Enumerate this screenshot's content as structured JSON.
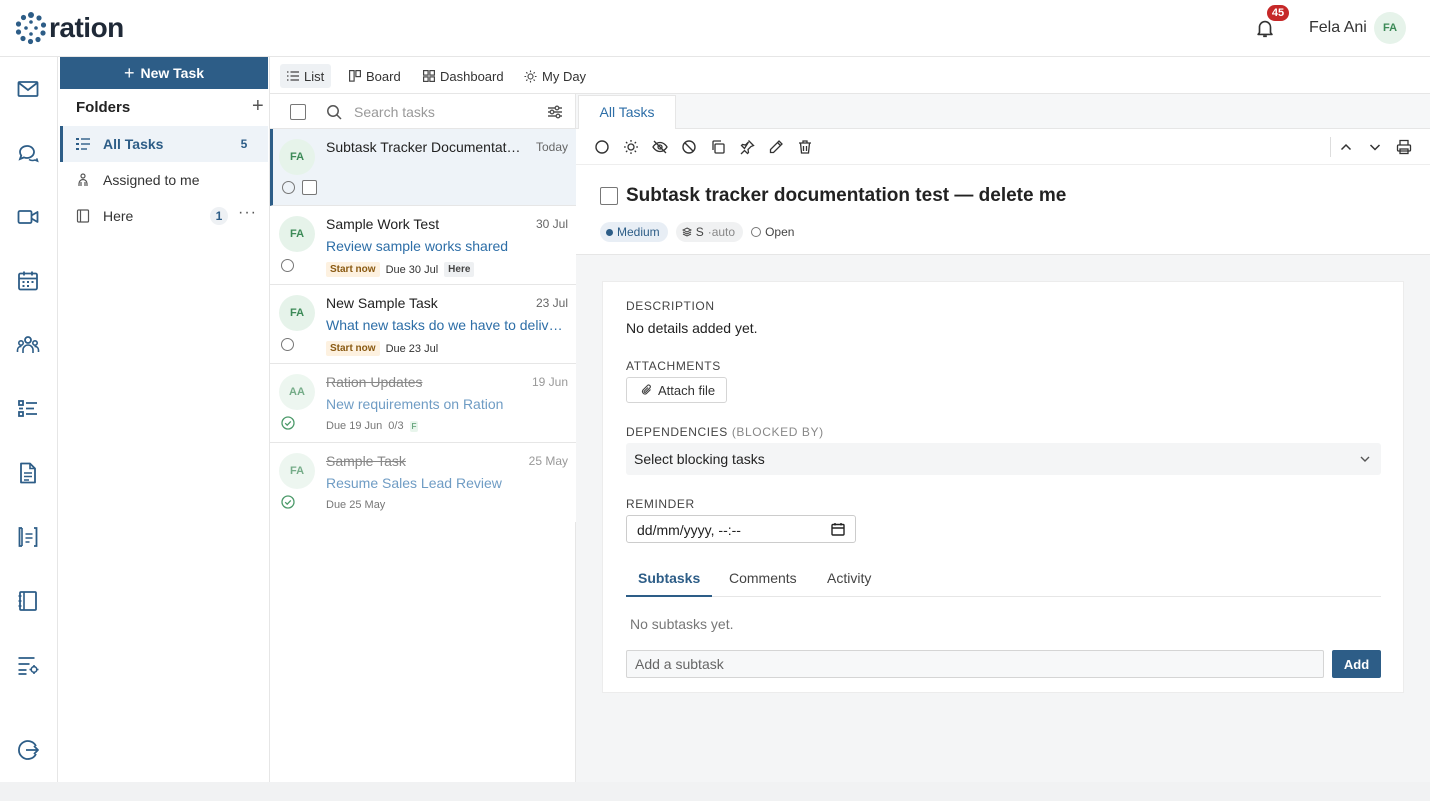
{
  "app": {
    "logo_text": "ration",
    "brand_color": "#2d5d87"
  },
  "header": {
    "notification_count": "45",
    "user_name": "Fela Ani",
    "user_initials": "FA"
  },
  "rail": {
    "icons": [
      "mail-icon",
      "chat-icon",
      "video-icon",
      "calendar-icon",
      "team-icon",
      "tasks-icon",
      "document-icon",
      "handbook-icon",
      "notebook-icon",
      "settings-list-icon",
      "logout-icon"
    ]
  },
  "folders": {
    "new_task_label": "New Task",
    "title": "Folders",
    "add_symbol": "+",
    "items": [
      {
        "label": "All Tasks",
        "count": "5",
        "active": true
      },
      {
        "label": "Assigned to me",
        "count": ""
      },
      {
        "label": "Here",
        "count": "1",
        "more": "···"
      }
    ]
  },
  "view_tabs": [
    {
      "label": "List",
      "active": true
    },
    {
      "label": "Board"
    },
    {
      "label": "Dashboard"
    },
    {
      "label": "My Day"
    }
  ],
  "task_list": {
    "search_placeholder": "Search tasks",
    "tasks": [
      {
        "initials": "FA",
        "title": "Subtask Tracker Documentation test — delete me",
        "date": "Today",
        "selected": true
      },
      {
        "initials": "FA",
        "title": "Sample Work Test",
        "date": "30 Jul",
        "subtitle": "Review sample works shared",
        "start": "Start now",
        "due": "Due 30 Jul",
        "tag": "Here"
      },
      {
        "initials": "FA",
        "title": "New Sample Task",
        "date": "23 Jul",
        "subtitle": "What new tasks do we have to deliver?",
        "start": "Start now",
        "due": "Due 23 Jul"
      },
      {
        "initials": "AA",
        "title": "Ration Updates",
        "date": "19 Jun",
        "subtitle": "New requirements on Ration",
        "due": "Due 19 Jun",
        "progress": "0/3",
        "flag": "F",
        "done": true
      },
      {
        "initials": "FA",
        "title": "Sample Task",
        "date": "25 May",
        "subtitle": "Resume Sales Lead Review",
        "due": "Due 25 May",
        "done": true
      }
    ]
  },
  "detail": {
    "tab_label": "All Tasks",
    "title": "Subtask tracker documentation test — delete me",
    "priority": "Medium",
    "size": "S",
    "size_suffix": "·auto",
    "status": "Open",
    "description_label": "DESCRIPTION",
    "description_text": "No details added yet.",
    "attachments_label": "ATTACHMENTS",
    "attach_button": "Attach file",
    "dependencies_label": "DEPENDENCIES",
    "dependencies_sub": "(BLOCKED BY)",
    "dependencies_placeholder": "Select blocking tasks",
    "reminder_label": "REMINDER",
    "reminder_value": "dd/mm/yyyy, --:--",
    "tabs": [
      "Subtasks",
      "Comments",
      "Activity"
    ],
    "active_tab": "Subtasks",
    "no_subtasks": "No subtasks yet.",
    "subtask_placeholder": "Add a subtask",
    "add_button": "Add"
  }
}
